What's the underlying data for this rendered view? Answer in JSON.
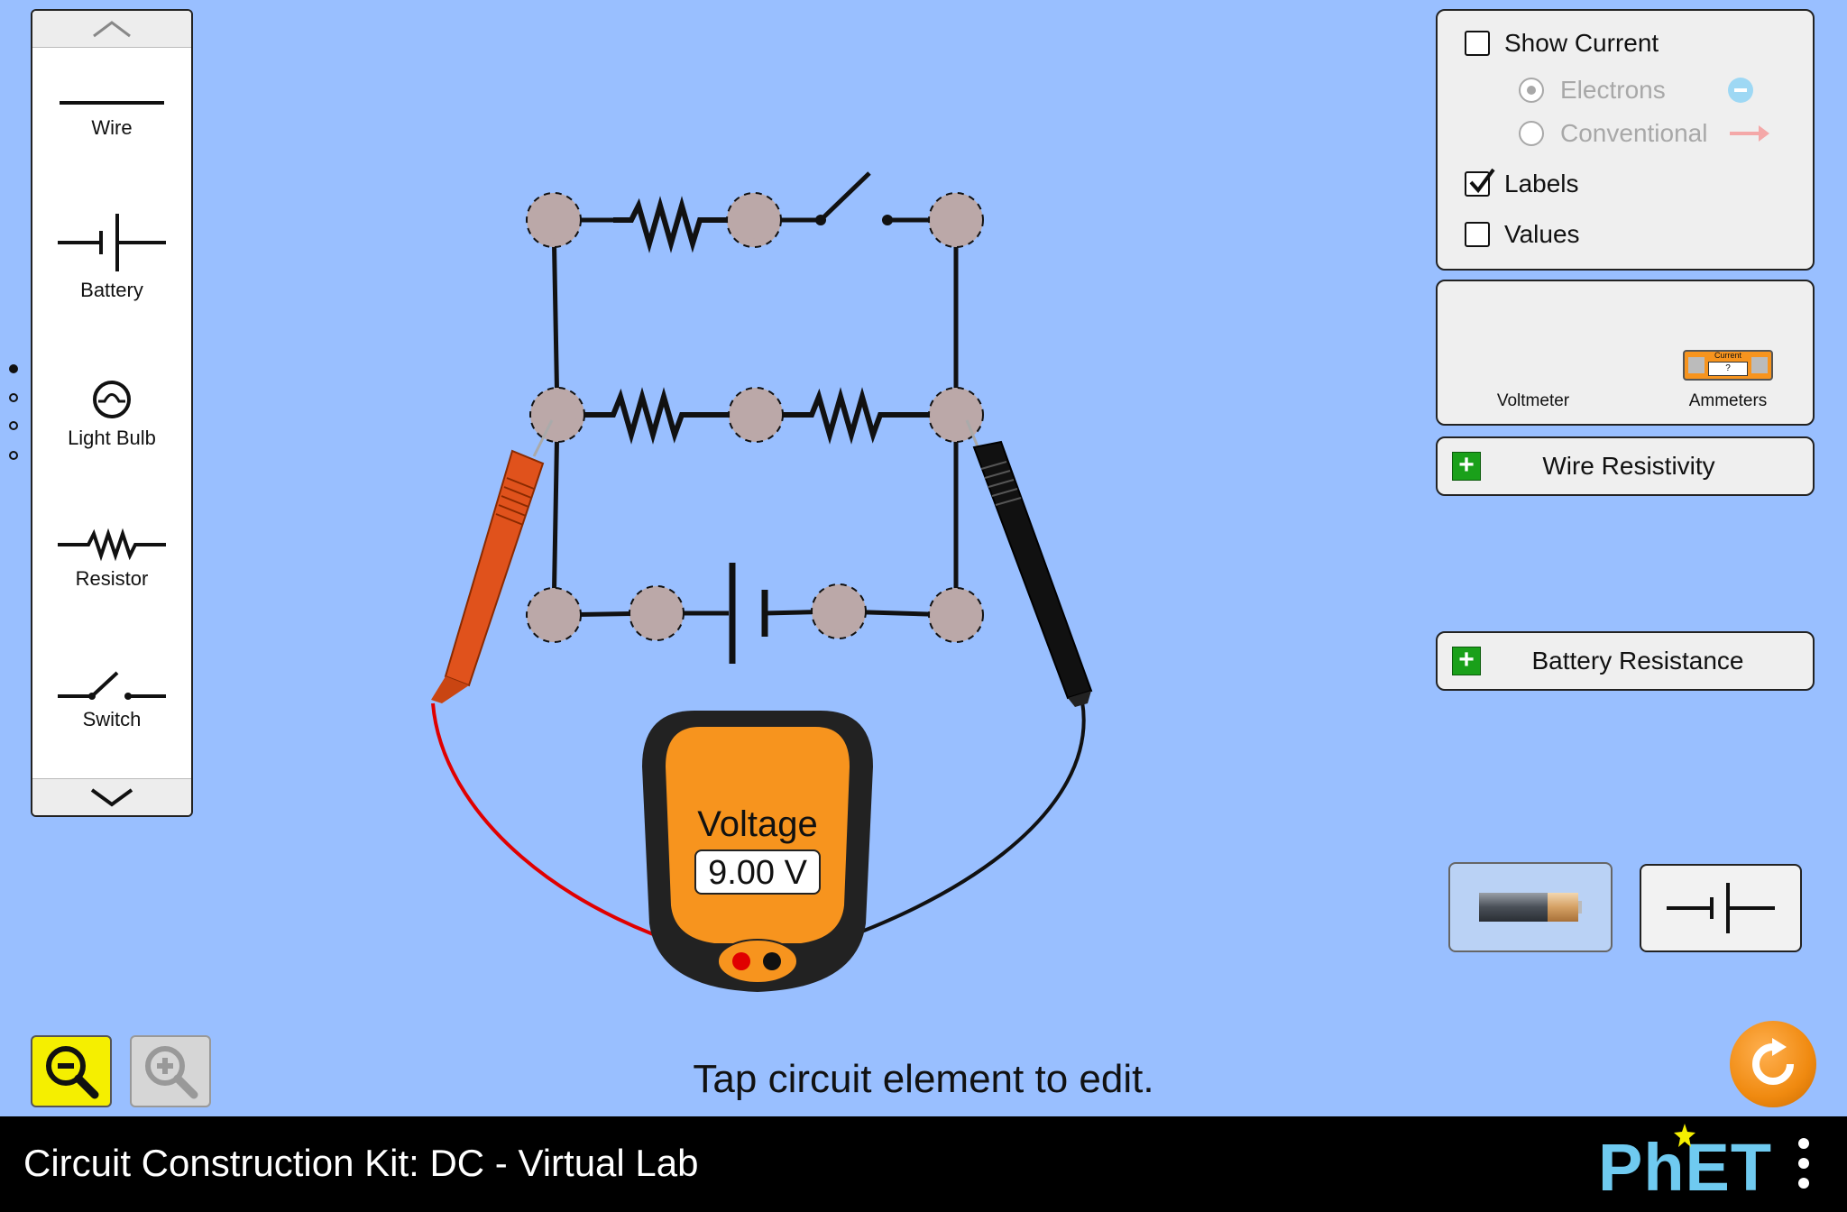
{
  "toolbox": {
    "items": [
      {
        "label": "Wire",
        "icon": "wire-icon"
      },
      {
        "label": "Battery",
        "icon": "battery-symbol-icon"
      },
      {
        "label": "Light Bulb",
        "icon": "light-bulb-icon"
      },
      {
        "label": "Resistor",
        "icon": "resistor-icon"
      },
      {
        "label": "Switch",
        "icon": "switch-icon"
      }
    ],
    "page_count": 4,
    "active_page": 1
  },
  "controls": {
    "show_current": {
      "label": "Show Current",
      "checked": false
    },
    "electrons": {
      "label": "Electrons",
      "selected": true
    },
    "conventional": {
      "label": "Conventional",
      "selected": false
    },
    "labels": {
      "label": "Labels",
      "checked": true
    },
    "values": {
      "label": "Values",
      "checked": false
    }
  },
  "sensors": {
    "voltmeter_label": "Voltmeter",
    "ammeters_label": "Ammeters",
    "ammeter_icon_title": "Current",
    "ammeter_icon_value": "?"
  },
  "wire_resistivity": {
    "label": "Wire Resistivity"
  },
  "battery_resistance": {
    "label": "Battery Resistance"
  },
  "voltmeter": {
    "title": "Voltage",
    "reading": "9.00 V"
  },
  "hint": "Tap circuit element to edit.",
  "app_title": "Circuit Construction Kit: DC - Virtual Lab",
  "brand": "PhET",
  "colors": {
    "background": "#99bfff",
    "meter_orange": "#f7941e",
    "red_probe": "#e0521c",
    "zoom_active": "#f5ef00",
    "phet_blue": "#6fcaf0"
  }
}
